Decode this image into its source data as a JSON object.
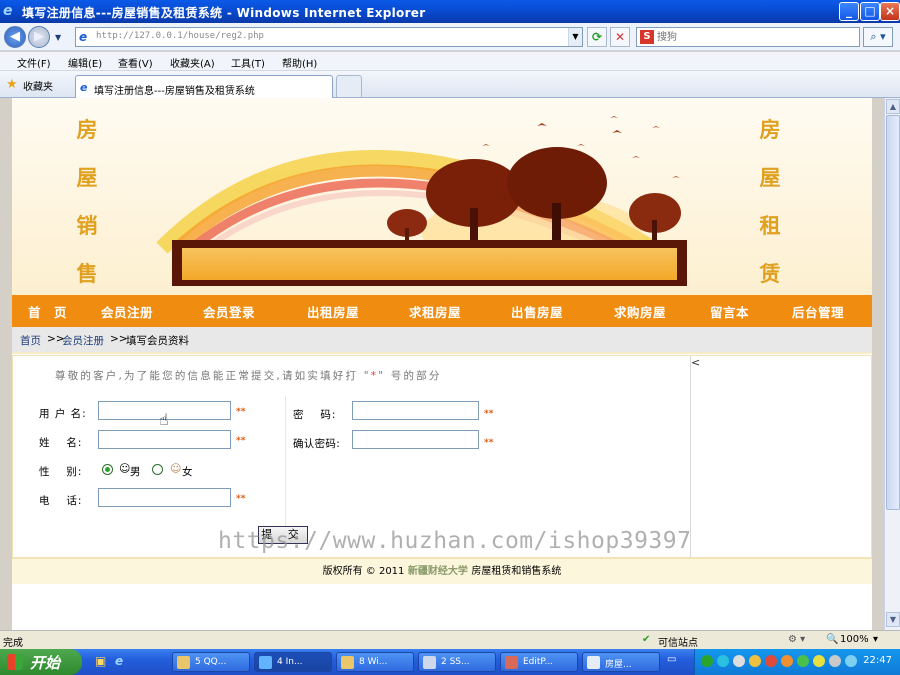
{
  "window": {
    "title": "填写注册信息---房屋销售及租赁系统 - Windows Internet Explorer",
    "minimize": "_",
    "maximize": "□",
    "close": "×"
  },
  "address": {
    "url": "http://127.0.0.1/house/reg2.php",
    "search_placeholder": "搜狗"
  },
  "menu": [
    "文件(F)",
    "编辑(E)",
    "查看(V)",
    "收藏夹(A)",
    "工具(T)",
    "帮助(H)"
  ],
  "favorites": {
    "label": "收藏夹"
  },
  "tab": {
    "title": "填写注册信息---房屋销售及租赁系统"
  },
  "banner": {
    "left_chars": [
      "房",
      "屋",
      "销",
      "售"
    ],
    "right_chars": [
      "房",
      "屋",
      "租",
      "赁"
    ]
  },
  "nav": [
    "首　页",
    "会员注册",
    "会员登录",
    "出租房屋",
    "求租房屋",
    "出售房屋",
    "求购房屋",
    "留言本",
    "后台管理"
  ],
  "breadcrumb": {
    "home": "首页",
    "sep": ">>",
    "reg": "会员注册",
    "current": "填写会员资料"
  },
  "form": {
    "notice_pre": "尊敬的客户,为了能您的信息能正常提交,请如实填好打 \"",
    "notice_star": "*",
    "notice_post": "\" 号的部分",
    "username_label": "用 户 名:",
    "name_label": "姓　 名:",
    "gender_label": "性　 别:",
    "male": "男",
    "female": "女",
    "phone_label": "电　 话:",
    "password_label": "密　 码:",
    "confirm_label": "确认密码:",
    "required": "**",
    "submit": "提 交",
    "panel_arrow": "<"
  },
  "footer": {
    "pre": "版权所有 © 2011",
    "university": "新疆财经大学",
    "post": "房屋租赁和销售系统"
  },
  "watermark": "https://www.huzhan.com/ishop39397",
  "status": {
    "left": "完成",
    "zone": "可信站点",
    "zoom": "100%"
  },
  "taskbar": {
    "start": "开始",
    "items": [
      "5 QQ...",
      "4 In...",
      "8 Wi...",
      "2 SS...",
      "EditP...",
      "房屋..."
    ],
    "clock": "22:47"
  }
}
